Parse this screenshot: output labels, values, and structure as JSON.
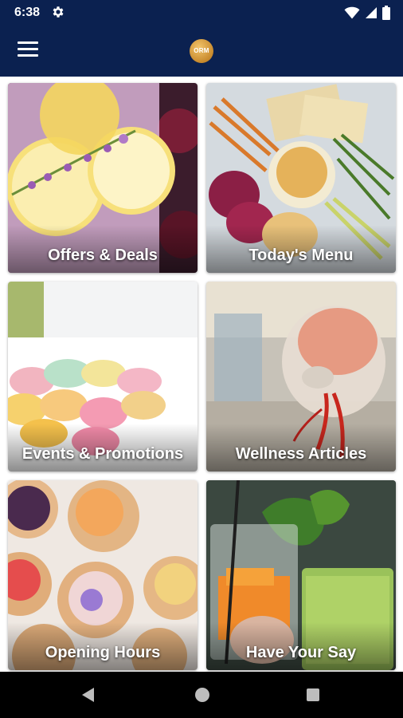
{
  "status_bar": {
    "time": "6:38",
    "icons": [
      "gear-icon",
      "wifi-icon",
      "signal-icon",
      "battery-icon"
    ]
  },
  "app_bar": {
    "logo_text": "ORM",
    "menu_icon": "hamburger-menu-icon",
    "background": "#0b2150"
  },
  "tiles": [
    {
      "label": "Offers & Deals",
      "image": "pink-citrus-drink-photo"
    },
    {
      "label": "Today's Menu",
      "image": "charcuterie-board-photo"
    },
    {
      "label": "Events & Promotions",
      "image": "macarons-box-photo"
    },
    {
      "label": "Wellness Articles",
      "image": "anatomy-skull-model-photo"
    },
    {
      "label": "Opening Hours",
      "image": "fruit-tarts-photo"
    },
    {
      "label": "Have Your Say",
      "image": "juices-drinks-photo"
    }
  ],
  "nav_bar": {
    "icons": [
      "back-icon",
      "home-icon",
      "recents-icon"
    ]
  }
}
